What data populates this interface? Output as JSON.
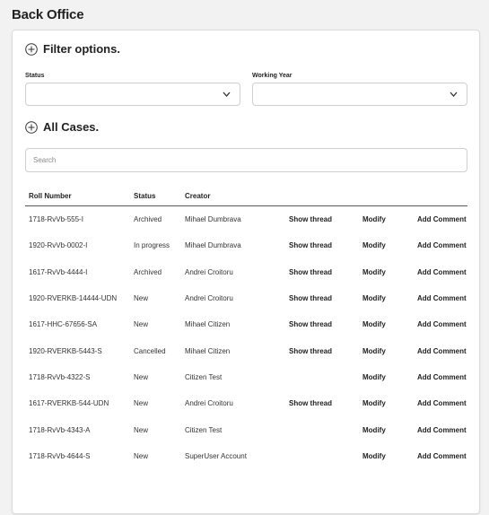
{
  "app": {
    "title": "Back Office"
  },
  "filters": {
    "title": "Filter options.",
    "status_label": "Status",
    "status_value": "",
    "year_label": "Working Year",
    "year_value": ""
  },
  "cases": {
    "title": "All Cases.",
    "search_placeholder": "Search",
    "columns": [
      "Roll Number",
      "Status",
      "Creator"
    ],
    "rows": [
      {
        "roll": "1718-RvVb-555-I",
        "status": "Archived",
        "creator": "Mihael Dumbrava",
        "thread": "Show thread",
        "modify": "Modify",
        "comment": "Add Comment"
      },
      {
        "roll": "1920-RvVb-0002-I",
        "status": "In progress",
        "creator": "Mihael Dumbrava",
        "thread": "Show thread",
        "modify": "Modify",
        "comment": "Add Comment"
      },
      {
        "roll": "1617-RvVb-4444-I",
        "status": "Archived",
        "creator": "Andrei Croitoru",
        "thread": "Show thread",
        "modify": "Modify",
        "comment": "Add Comment"
      },
      {
        "roll": "1920-RVERKB-14444-UDN",
        "status": "New",
        "creator": "Andrei Croitoru",
        "thread": "Show thread",
        "modify": "Modify",
        "comment": "Add Comment"
      },
      {
        "roll": "1617-HHC-67656-SA",
        "status": "New",
        "creator": "Mihael Citizen",
        "thread": "Show thread",
        "modify": "Modify",
        "comment": "Add Comment"
      },
      {
        "roll": "1920-RVERKB-5443-S",
        "status": "Cancelled",
        "creator": "Mihael Citizen",
        "thread": "Show thread",
        "modify": "Modify",
        "comment": "Add Comment"
      },
      {
        "roll": "1718-RvVb-4322-S",
        "status": "New",
        "creator": "Citizen Test",
        "thread": "",
        "modify": "Modify",
        "comment": "Add Comment"
      },
      {
        "roll": "1617-RVERKB-544-UDN",
        "status": "New",
        "creator": "Andrei Croitoru",
        "thread": "Show thread",
        "modify": "Modify",
        "comment": "Add Comment"
      },
      {
        "roll": "1718-RvVb-4343-A",
        "status": "New",
        "creator": "Citizen Test",
        "thread": "",
        "modify": "Modify",
        "comment": "Add Comment"
      },
      {
        "roll": "1718-RvVb-4644-S",
        "status": "New",
        "creator": "SuperUser Account",
        "thread": "",
        "modify": "Modify",
        "comment": "Add Comment"
      }
    ]
  },
  "icons": {
    "section": "plus-circle-icon",
    "dropdown": "chevron-down-icon"
  }
}
